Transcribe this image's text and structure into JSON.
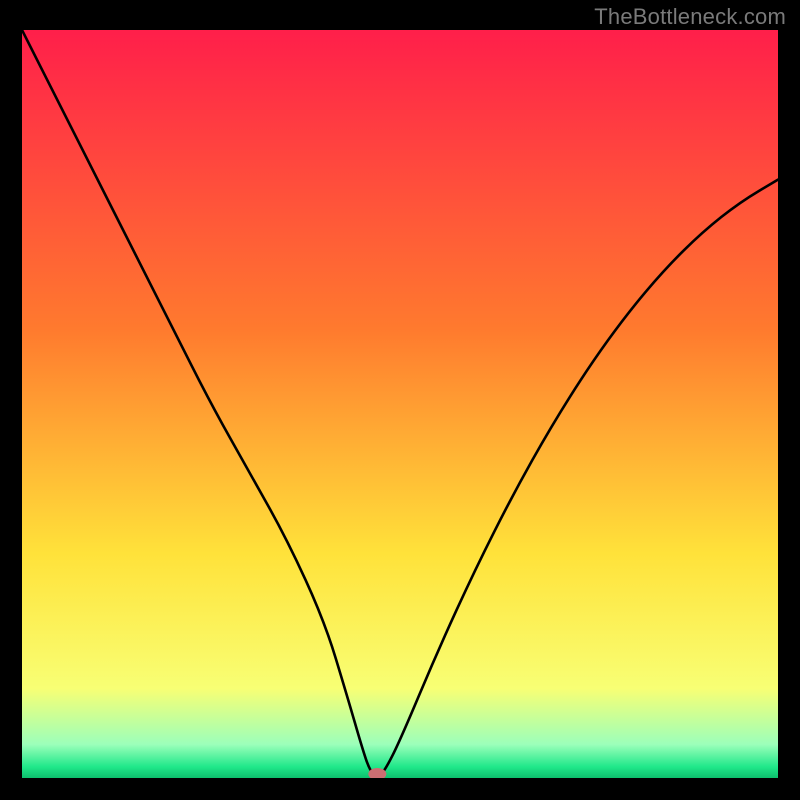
{
  "watermark": "TheBottleneck.com",
  "chart_data": {
    "type": "line",
    "title": "",
    "xlabel": "",
    "ylabel": "",
    "xlim": [
      0,
      100
    ],
    "ylim": [
      0,
      100
    ],
    "x": [
      0,
      5,
      10,
      15,
      20,
      25,
      30,
      35,
      40,
      43,
      45,
      46,
      47,
      48,
      50,
      55,
      60,
      65,
      70,
      75,
      80,
      85,
      90,
      95,
      100
    ],
    "values": [
      100,
      90,
      80,
      70,
      60,
      50,
      41,
      32,
      21,
      11,
      4,
      1,
      0,
      1,
      5,
      17,
      28,
      38,
      47,
      55,
      62,
      68,
      73,
      77,
      80
    ],
    "minimum_x": 47,
    "marker": {
      "x": 47,
      "y": 0
    },
    "gradient_stops": [
      {
        "pos": 0.0,
        "color": "#ff1f4a"
      },
      {
        "pos": 0.4,
        "color": "#ff7a2e"
      },
      {
        "pos": 0.7,
        "color": "#ffe23a"
      },
      {
        "pos": 0.88,
        "color": "#f8ff74"
      },
      {
        "pos": 0.955,
        "color": "#9cffba"
      },
      {
        "pos": 0.985,
        "color": "#20e88a"
      },
      {
        "pos": 1.0,
        "color": "#0dbf6d"
      }
    ]
  }
}
